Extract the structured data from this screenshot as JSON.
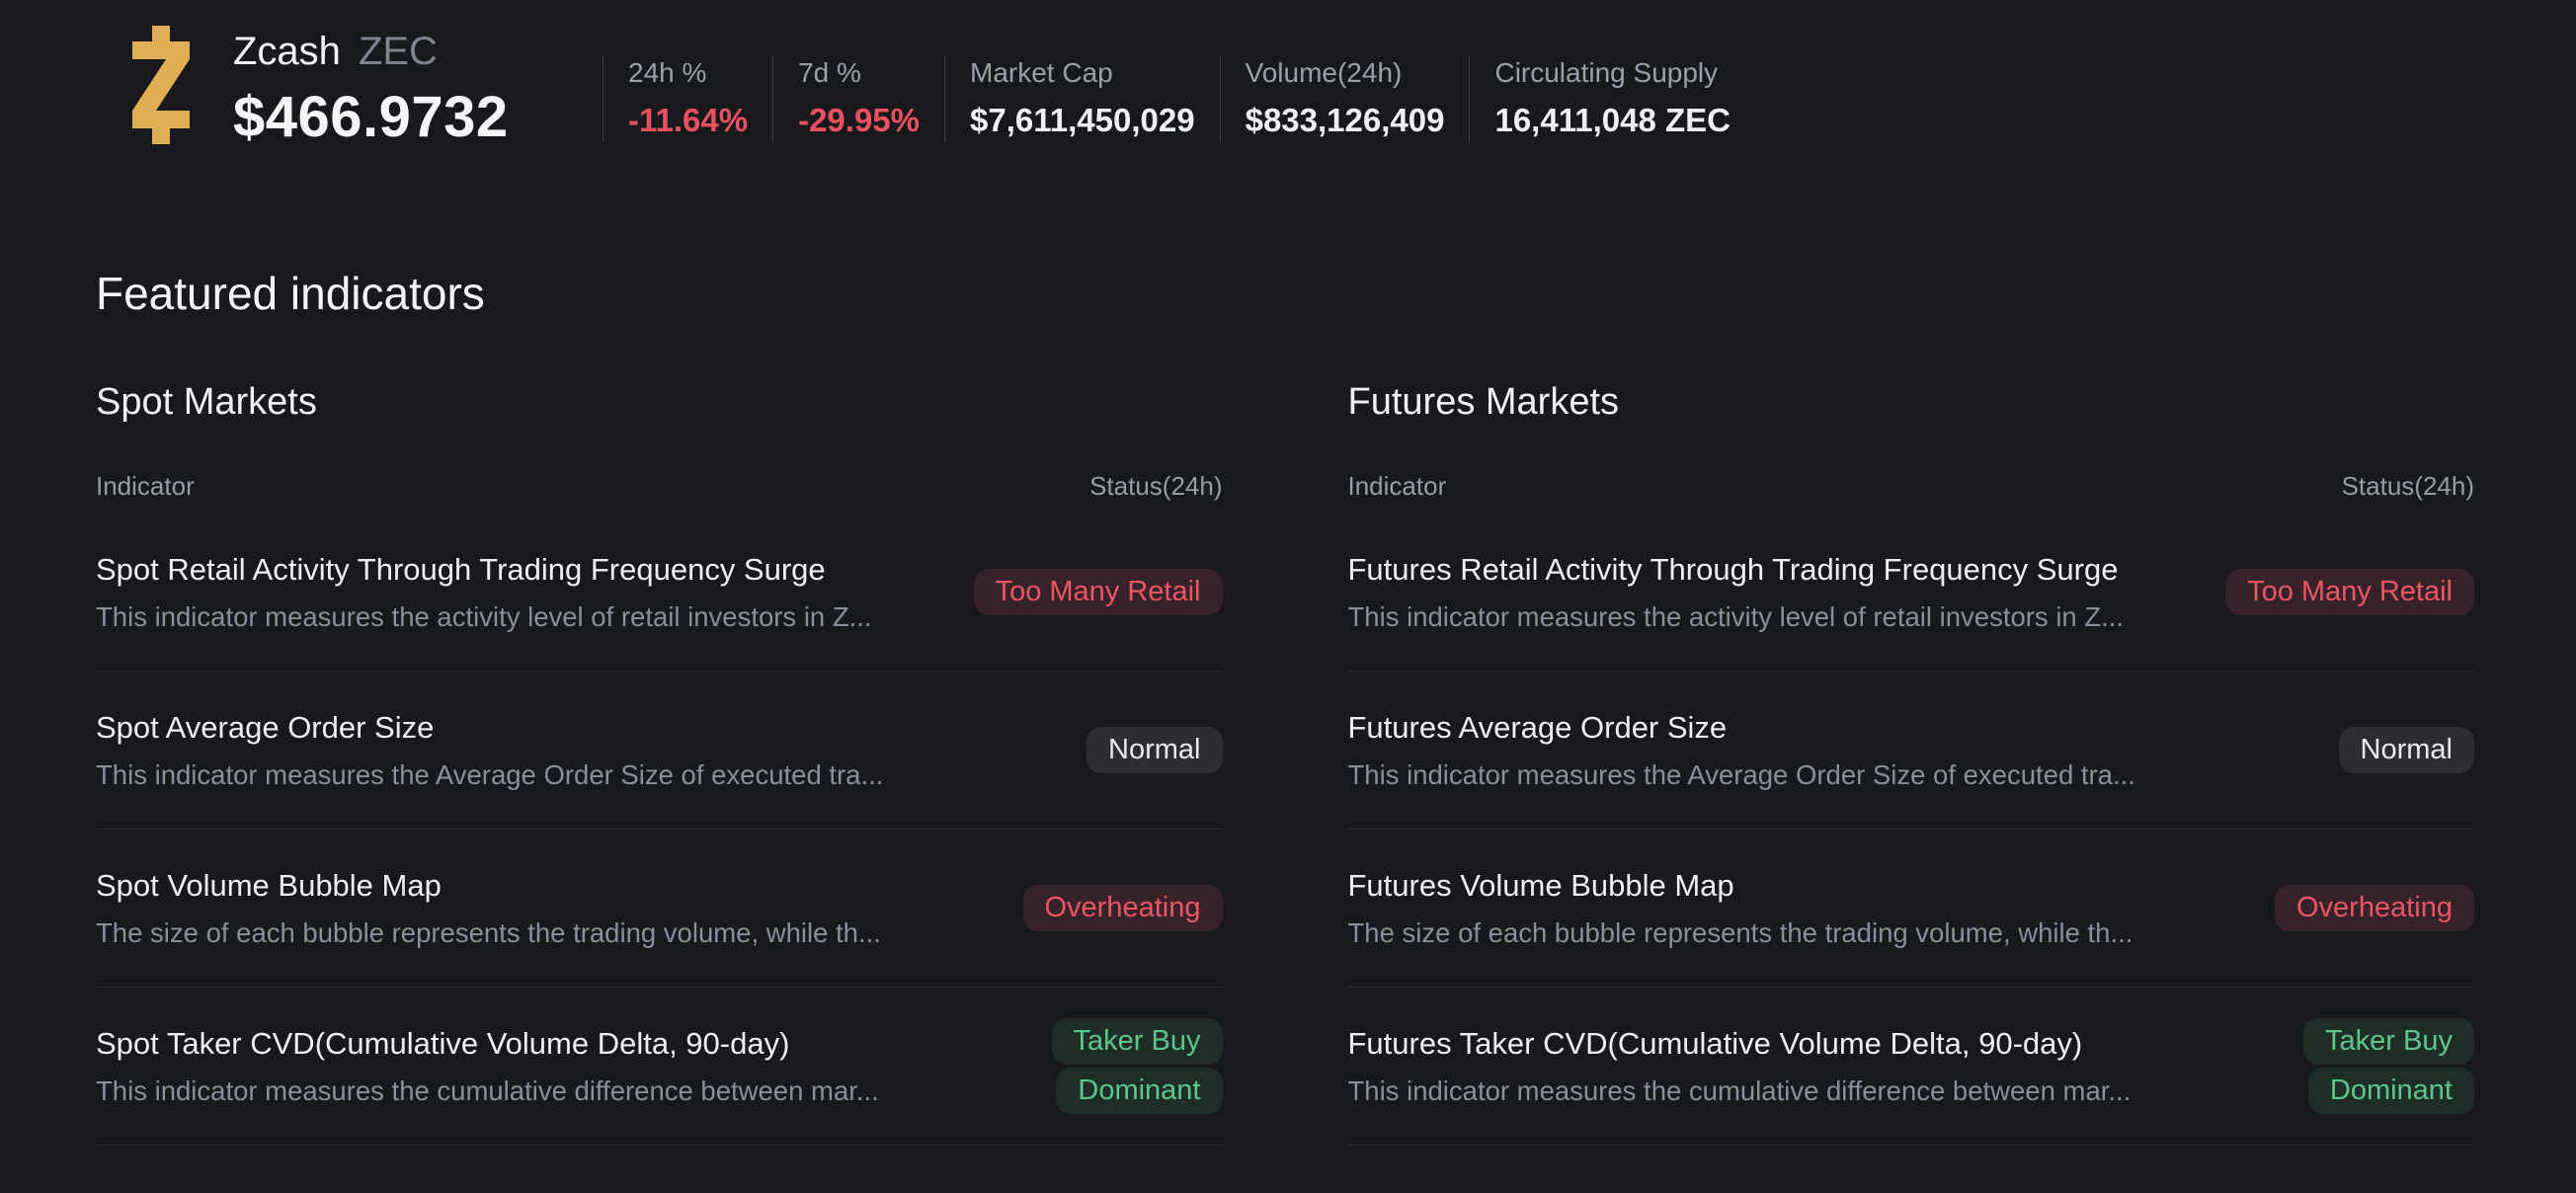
{
  "colors": {
    "background": "#18191d",
    "logo_gold": "#dfae54",
    "negative_red": "#e8515f",
    "positive_green": "#5dc78b",
    "danger_badge_bg": "#362228",
    "neutral_badge_bg": "#2c2e33",
    "success_badge_bg": "#1f2d27"
  },
  "header": {
    "logo_icon": "zcash-logo",
    "coin_name": "Zcash",
    "coin_symbol": "ZEC",
    "price": "$466.9732",
    "stats": [
      {
        "label": "24h %",
        "value": "-11.64%",
        "trend": "negative"
      },
      {
        "label": "7d %",
        "value": "-29.95%",
        "trend": "negative"
      },
      {
        "label": "Market Cap",
        "value": "$7,611,450,029",
        "trend": "neutral"
      },
      {
        "label": "Volume(24h)",
        "value": "$833,126,409",
        "trend": "neutral"
      },
      {
        "label": "Circulating Supply",
        "value": "16,411,048 ZEC",
        "trend": "neutral"
      }
    ]
  },
  "featured": {
    "title": "Featured indicators"
  },
  "sections": {
    "spot": {
      "title": "Spot Markets",
      "columns": {
        "indicator": "Indicator",
        "status": "Status(24h)"
      },
      "rows": [
        {
          "title": "Spot Retail Activity Through Trading Frequency Surge",
          "description": "This indicator measures the activity level of retail investors in Z...",
          "status": "Too Many Retail",
          "status_type": "danger"
        },
        {
          "title": "Spot Average Order Size",
          "description": "This indicator measures the Average Order Size of executed tra...",
          "status": "Normal",
          "status_type": "neutral"
        },
        {
          "title": "Spot Volume Bubble Map",
          "description": "The size of each bubble represents the trading volume, while th...",
          "status": "Overheating",
          "status_type": "danger"
        },
        {
          "title": "Spot Taker CVD(Cumulative Volume Delta, 90-day)",
          "description": "This indicator measures the cumulative difference between mar...",
          "status": "Taker Buy Dominant",
          "status_lines": [
            "Taker Buy",
            "Dominant"
          ],
          "status_type": "success"
        }
      ]
    },
    "futures": {
      "title": "Futures Markets",
      "columns": {
        "indicator": "Indicator",
        "status": "Status(24h)"
      },
      "rows": [
        {
          "title": "Futures Retail Activity Through Trading Frequency Surge",
          "description": "This indicator measures the activity level of retail investors in Z...",
          "status": "Too Many Retail",
          "status_type": "danger"
        },
        {
          "title": "Futures Average Order Size",
          "description": "This indicator measures the Average Order Size of executed tra...",
          "status": "Normal",
          "status_type": "neutral"
        },
        {
          "title": "Futures Volume Bubble Map",
          "description": "The size of each bubble represents the trading volume, while th...",
          "status": "Overheating",
          "status_type": "danger"
        },
        {
          "title": "Futures Taker CVD(Cumulative Volume Delta, 90-day)",
          "description": "This indicator measures the cumulative difference between mar...",
          "status": "Taker Buy Dominant",
          "status_lines": [
            "Taker Buy",
            "Dominant"
          ],
          "status_type": "success"
        }
      ]
    }
  }
}
